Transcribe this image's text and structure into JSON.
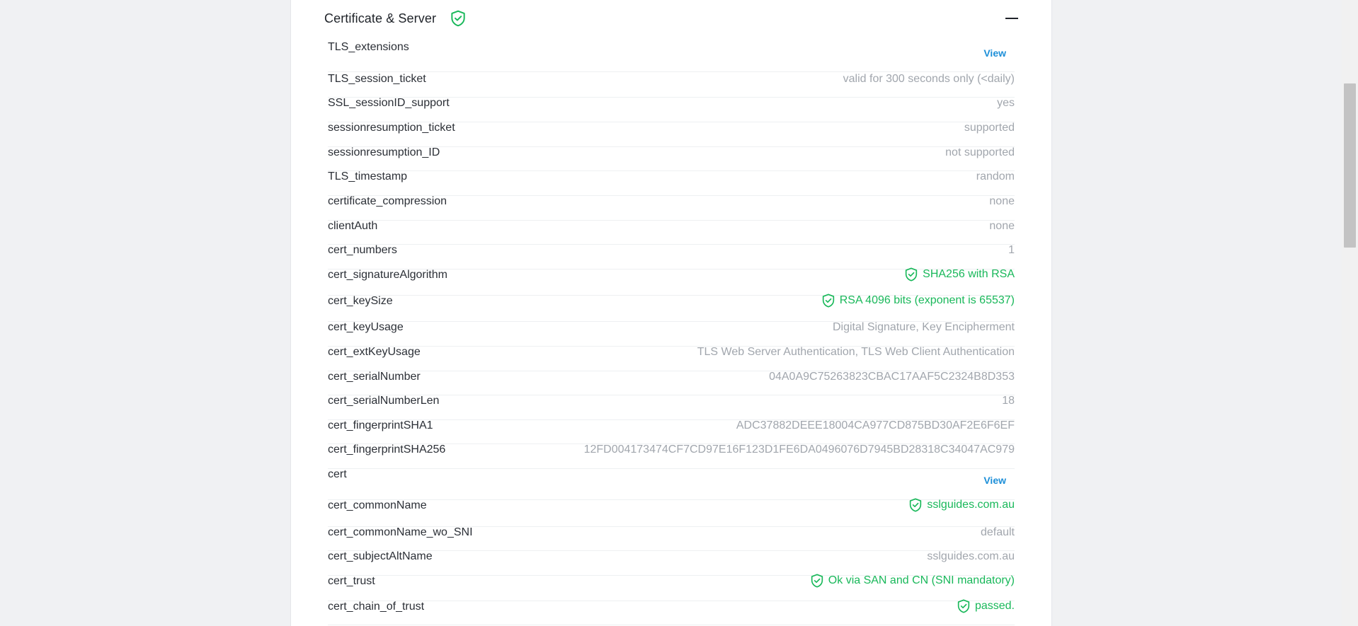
{
  "section": {
    "title": "Certificate & Server",
    "collapse_icon": "minus-icon",
    "status_icon": "shield-check-icon"
  },
  "colors": {
    "good": "#19b85a",
    "muted": "#a1a6ad",
    "link": "#1d8fd8"
  },
  "rows": [
    {
      "key": "TLS_extensions",
      "link": "View"
    },
    {
      "key": "TLS_session_ticket",
      "value": "valid for 300 seconds only (<daily)"
    },
    {
      "key": "SSL_sessionID_support",
      "value": "yes"
    },
    {
      "key": "sessionresumption_ticket",
      "value": "supported"
    },
    {
      "key": "sessionresumption_ID",
      "value": "not supported"
    },
    {
      "key": "TLS_timestamp",
      "value": "random"
    },
    {
      "key": "certificate_compression",
      "value": "none"
    },
    {
      "key": "clientAuth",
      "value": "none"
    },
    {
      "key": "cert_numbers",
      "value": "1"
    },
    {
      "key": "cert_signatureAlgorithm",
      "value": "SHA256 with RSA",
      "status": "good"
    },
    {
      "key": "cert_keySize",
      "value": "RSA 4096 bits (exponent is 65537)",
      "status": "good"
    },
    {
      "key": "cert_keyUsage",
      "value": "Digital Signature, Key Encipherment"
    },
    {
      "key": "cert_extKeyUsage",
      "value": "TLS Web Server Authentication, TLS Web Client Authentication"
    },
    {
      "key": "cert_serialNumber",
      "value": "04A0A9C75263823CBAC17AAF5C2324B8D353"
    },
    {
      "key": "cert_serialNumberLen",
      "value": "18"
    },
    {
      "key": "cert_fingerprintSHA1",
      "value": "ADC37882DEEE18004CA977CD875BD30AF2E6F6EF"
    },
    {
      "key": "cert_fingerprintSHA256",
      "value": "12FD004173474CF7CD97E16F123D1FE6DA0496076D7945BD28318C34047AC979"
    },
    {
      "key": "cert",
      "link": "View"
    },
    {
      "key": "cert_commonName",
      "value": "sslguides.com.au",
      "status": "good"
    },
    {
      "key": "cert_commonName_wo_SNI",
      "value": "default"
    },
    {
      "key": "cert_subjectAltName",
      "value": "sslguides.com.au"
    },
    {
      "key": "cert_trust",
      "value": "Ok via SAN and CN (SNI mandatory)",
      "status": "good"
    },
    {
      "key": "cert_chain_of_trust",
      "value": "passed.",
      "status": "good"
    }
  ]
}
